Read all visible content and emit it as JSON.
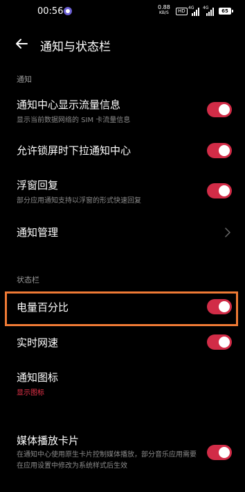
{
  "status_bar": {
    "time": "00:56",
    "net_speed_value": "0.88",
    "net_speed_unit": "KB/S",
    "hd_label": "HD",
    "sim1_tag": "4G",
    "sim2_tag": "4G",
    "battery": "65"
  },
  "header": {
    "title": "通知与状态栏"
  },
  "sections": {
    "notification": {
      "header": "通知",
      "items": [
        {
          "title": "通知中心显示流量信息",
          "subtitle": "显示当前数据网络的 SIM 卡流量信息",
          "toggle_on": true
        },
        {
          "title": "允许锁屏时下拉通知中心",
          "toggle_on": true
        },
        {
          "title": "浮窗回复",
          "subtitle": "部分应用通知支持以浮窗的形式快速回复",
          "toggle_on": true
        },
        {
          "title": "通知管理"
        }
      ]
    },
    "status_bar": {
      "header": "状态栏",
      "items": [
        {
          "title": "电量百分比",
          "toggle_on": true
        },
        {
          "title": "实时网速",
          "toggle_on": true
        },
        {
          "title": "通知图标",
          "subtitle": "显示图标"
        },
        {
          "title": "媒体播放卡片",
          "subtitle": "在通知中心使用原生卡片控制媒体播放，部分音乐应用需要在应用设置中修改为系统样式后生效",
          "toggle_on": true
        }
      ]
    }
  },
  "colors": {
    "background": "#000000",
    "toggle_on": "#d12c47",
    "accent_text": "#e8334a",
    "highlight": "#ef7a35"
  }
}
